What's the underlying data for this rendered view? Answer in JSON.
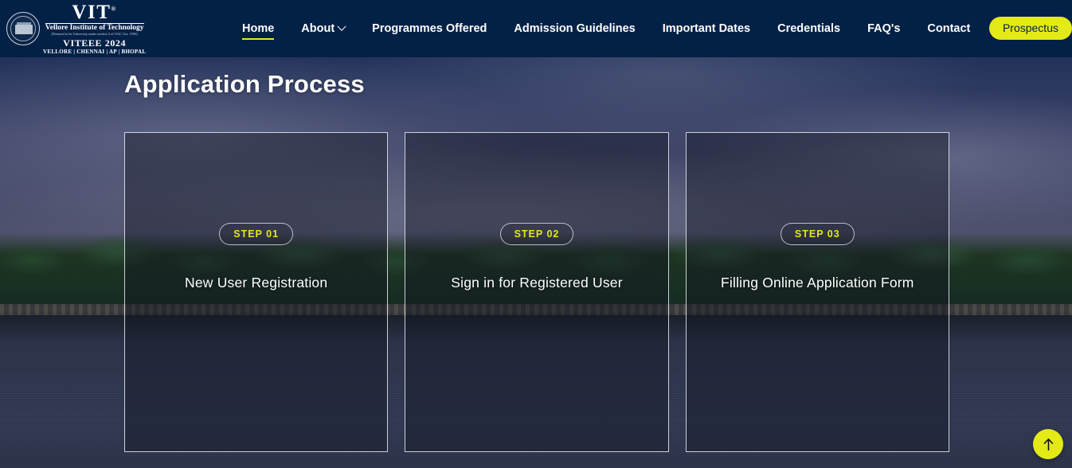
{
  "header": {
    "logo": {
      "seal_icon": "vit-seal-icon",
      "acronym": "VIT",
      "registered_mark": "®",
      "institute_name": "Vellore Institute of Technology",
      "institute_subline": "(Deemed to be University under section 3 of UGC Act, 1956)",
      "exam_name": "VITEEE 2024",
      "campuses": "VELLORE | CHENNAI | AP | BHOPAL"
    },
    "nav_items": [
      {
        "label": "Home",
        "active": true,
        "has_dropdown": false
      },
      {
        "label": "About",
        "active": false,
        "has_dropdown": true,
        "dropdown_icon": "chevron-down-icon"
      },
      {
        "label": "Programmes Offered",
        "active": false,
        "has_dropdown": false
      },
      {
        "label": "Admission Guidelines",
        "active": false,
        "has_dropdown": false
      },
      {
        "label": "Important Dates",
        "active": false,
        "has_dropdown": false
      },
      {
        "label": "Credentials",
        "active": false,
        "has_dropdown": false
      },
      {
        "label": "FAQ's",
        "active": false,
        "has_dropdown": false
      },
      {
        "label": "Contact",
        "active": false,
        "has_dropdown": false
      }
    ],
    "prospectus_label": "Prospectus",
    "background_color": "#032147",
    "accent_color": "#e3ea16"
  },
  "main": {
    "page_title": "Application Process",
    "cards": [
      {
        "step_label": "STEP 01",
        "title": "New User Registration"
      },
      {
        "step_label": "STEP 02",
        "title": "Sign in for Registered User"
      },
      {
        "step_label": "STEP 03",
        "title": "Filling Online Application Form"
      }
    ]
  },
  "scroll_top": {
    "icon": "arrow-up-icon",
    "background_color": "#e3ea16"
  }
}
